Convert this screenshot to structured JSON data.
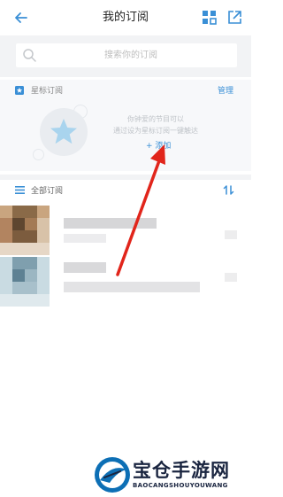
{
  "header": {
    "title": "我的订阅"
  },
  "search": {
    "placeholder": "搜索你的订阅"
  },
  "starred": {
    "title": "星标订阅",
    "manage": "管理",
    "hint_line1": "你钟爱的节目可以",
    "hint_line2": "通过设为星标订阅一键触达",
    "add": "+ 添加"
  },
  "all": {
    "title": "全部订阅"
  },
  "colors": {
    "accent": "#3a8fd6",
    "annotation": "#e1251b",
    "section_bg": "#f7f8fa"
  },
  "icons": {
    "back": "arrow-left-icon",
    "grid": "grid-icon",
    "share": "share-icon",
    "search": "search-icon",
    "star": "star-icon",
    "list": "list-icon",
    "sort": "sort-icon"
  },
  "watermark": {
    "title": "宝仓手游网",
    "subtitle": "BAOCANGSHOUYOUWANG"
  }
}
